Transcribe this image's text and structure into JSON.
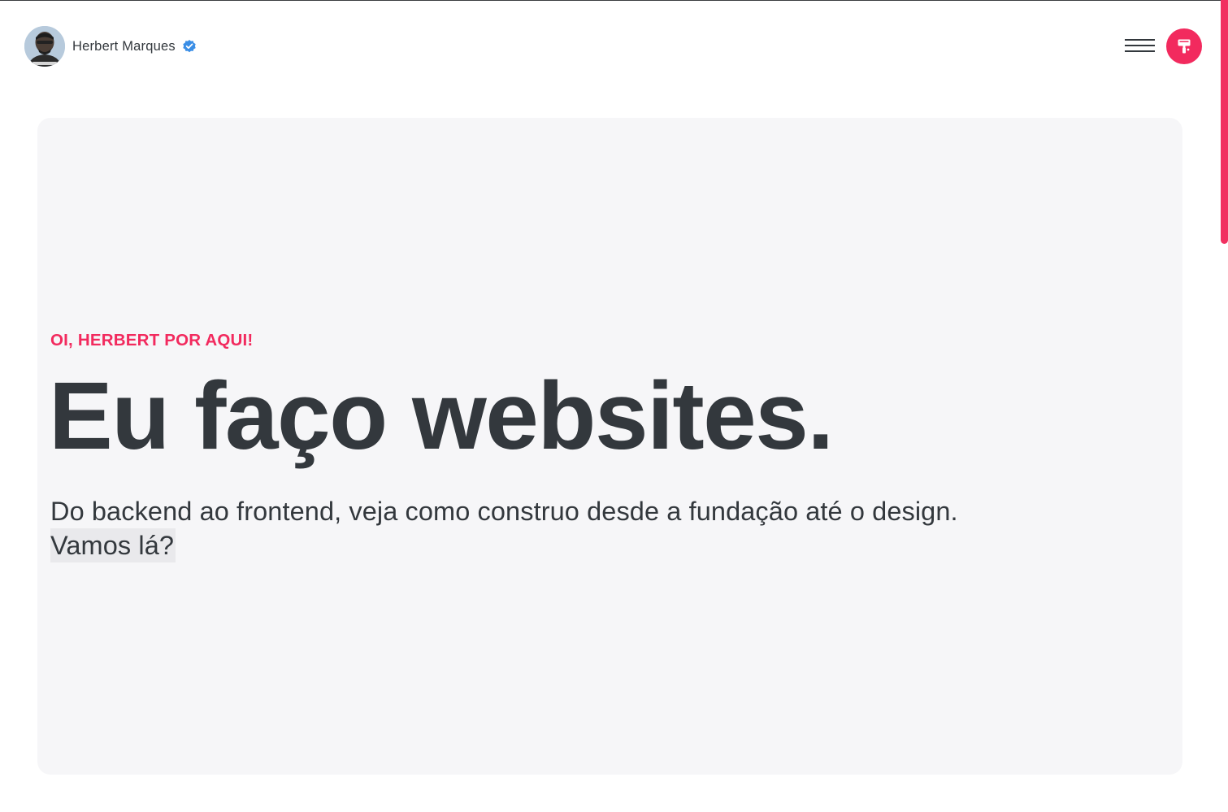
{
  "header": {
    "brand_name": "Herbert Marques",
    "avatar_icon": "person-portrait-avatar",
    "verified_icon": "verified-badge-icon",
    "menu_icon": "hamburger-menu-icon",
    "theme_icon": "paint-roller-icon"
  },
  "hero": {
    "kicker": "OI, HERBERT POR AQUI!",
    "headline": "Eu faço websites.",
    "lede": "Do backend ao frontend, veja como construo desde a fundação até o design.",
    "cta": "Vamos lá?"
  },
  "colors": {
    "accent": "#f22a5e",
    "text": "#33383d",
    "panel": "#f6f6f8",
    "verified": "#3a8ee6"
  }
}
